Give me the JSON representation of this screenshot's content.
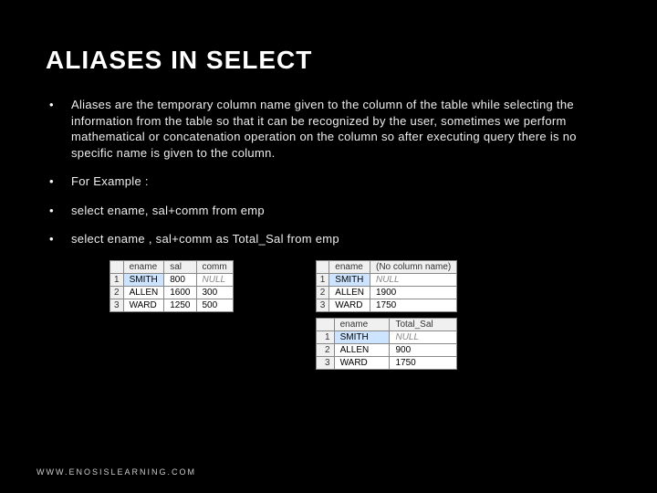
{
  "title": "ALIASES IN SELECT",
  "bullets": {
    "b0": "Aliases are the temporary column name given to the column of the table while selecting the information from the table so that it can be recognized by the user, sometimes we perform mathematical or  concatenation operation on the column so after executing query there is no specific name is given to the column.",
    "b1": "For Example :",
    "b2": "select ename, sal+comm from emp",
    "b3": "select ename , sal+comm as Total_Sal from emp"
  },
  "tableA": {
    "headers": {
      "c0": "",
      "c1": "ename",
      "c2": "sal",
      "c3": "comm"
    },
    "rows": [
      {
        "n": "1",
        "c1": "SMITH",
        "c2": "800",
        "c3": "NULL"
      },
      {
        "n": "2",
        "c1": "ALLEN",
        "c2": "1600",
        "c3": "300"
      },
      {
        "n": "3",
        "c1": "WARD",
        "c2": "1250",
        "c3": "500"
      }
    ]
  },
  "tableB": {
    "headers": {
      "c0": "",
      "c1": "ename",
      "c2": "(No column name)"
    },
    "rows": [
      {
        "n": "1",
        "c1": "SMITH",
        "c2": "NULL"
      },
      {
        "n": "2",
        "c1": "ALLEN",
        "c2": "1900"
      },
      {
        "n": "3",
        "c1": "WARD",
        "c2": "1750"
      }
    ]
  },
  "tableC": {
    "headers": {
      "c0": "",
      "c1": "ename",
      "c2": "Total_Sal"
    },
    "rows": [
      {
        "n": "1",
        "c1": "SMITH",
        "c2": "NULL"
      },
      {
        "n": "2",
        "c1": "ALLEN",
        "c2": "900"
      },
      {
        "n": "3",
        "c1": "WARD",
        "c2": "1750"
      }
    ]
  },
  "footer": "WWW.ENOSISLEARNING.COM"
}
